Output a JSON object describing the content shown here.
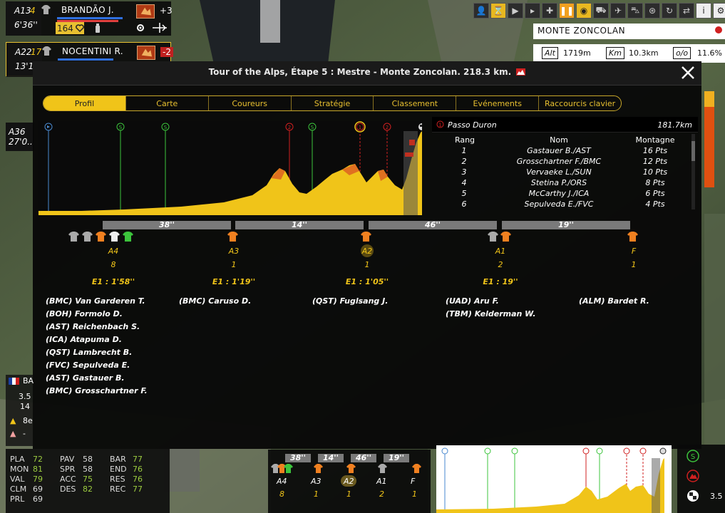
{
  "riders": [
    {
      "team_code": "A13",
      "num": "4",
      "time": "6'36''",
      "name": "BRANDÃO J.",
      "delta": "+3",
      "energy": "164"
    },
    {
      "team_code": "A22",
      "num": "17",
      "time": "13'1..",
      "name": "NOCENTINI R.",
      "delta": "-2"
    },
    {
      "team_code": "A36",
      "time": "27'0.."
    }
  ],
  "climb_panel": {
    "title": "MONTE ZONCOLAN",
    "alt_key": "Alt",
    "alt": "1719m",
    "km_key": "Km",
    "km": "10.3km",
    "grade_key": "o/o",
    "grade": "11.6%"
  },
  "modal": {
    "title": "Tour of the Alps, Étape 5 : Mestre - Monte Zoncolan. 218.3 km.",
    "tabs": [
      "Profil",
      "Carte",
      "Coureurs",
      "Stratégie",
      "Classement",
      "Evénements",
      "Raccourcis clavier"
    ],
    "active_tab": "Profil"
  },
  "climb_table": {
    "name": "Passo Duron",
    "km": "181.7km",
    "headers": [
      "Rang",
      "Nom",
      "Montagne"
    ],
    "rows": [
      {
        "rank": "1",
        "name": "Gastauer B./AST",
        "pts": "16 Pts"
      },
      {
        "rank": "2",
        "name": "Grosschartner F./BMC",
        "pts": "12 Pts"
      },
      {
        "rank": "3",
        "name": "Vervaeke L./SUN",
        "pts": "10 Pts"
      },
      {
        "rank": "4",
        "name": "Stetina P./ORS",
        "pts": "8 Pts"
      },
      {
        "rank": "5",
        "name": "McCarthy J./ICA",
        "pts": "6 Pts"
      },
      {
        "rank": "6",
        "name": "Sepulveda E./FVC",
        "pts": "4 Pts"
      }
    ]
  },
  "gaps": [
    "38''",
    "14''",
    "46''",
    "19''"
  ],
  "groups": [
    {
      "label": "A4",
      "count": "8",
      "gap": "E1 : 1'58''",
      "riders": [
        "(BMC) Van Garderen T.",
        "(BOH) Formolo D.",
        "(AST) Reichenbach S.",
        "(ICA) Atapuma D.",
        "(QST) Lambrecht B.",
        "(FVC) Sepulveda E.",
        "(AST) Gastauer B.",
        "(BMC) Grosschartner F."
      ]
    },
    {
      "label": "A3",
      "count": "1",
      "gap": "E1 : 1'19''",
      "riders": [
        "(BMC) Caruso D."
      ]
    },
    {
      "label": "A2",
      "count": "1",
      "gap": "E1 : 1'05''",
      "riders": [
        "(QST) Fuglsang J."
      ]
    },
    {
      "label": "A1",
      "count": "2",
      "gap": "E1 : 19''",
      "riders": [
        "(UAD) Aru F.",
        "(TBM) Kelderman W."
      ]
    },
    {
      "label": "F",
      "count": "1",
      "gap": "",
      "riders": [
        "(ALM) Bardet R."
      ]
    }
  ],
  "stats": [
    {
      "k": "PLA",
      "v": "72"
    },
    {
      "k": "PAV",
      "v": "58"
    },
    {
      "k": "BAR",
      "v": "77"
    },
    {
      "k": "MON",
      "v": "81"
    },
    {
      "k": "SPR",
      "v": "58"
    },
    {
      "k": "END",
      "v": "76"
    },
    {
      "k": "VAL",
      "v": "79"
    },
    {
      "k": "ACC",
      "v": "75"
    },
    {
      "k": "RES",
      "v": "76"
    },
    {
      "k": "CLM",
      "v": "69"
    },
    {
      "k": "DES",
      "v": "82"
    },
    {
      "k": "REC",
      "v": "77"
    },
    {
      "k": "PRL",
      "v": "69"
    }
  ],
  "mini_groups": {
    "gaps": [
      "38''",
      "14''",
      "46''",
      "19''"
    ],
    "labels": [
      "A4",
      "A3",
      "A2",
      "A1",
      "F"
    ],
    "counts": [
      "8",
      "1",
      "1",
      "2",
      "1"
    ]
  },
  "bottom_left": {
    "v1": "3.5",
    "v2": "14",
    "v3": "8e",
    "v4": "-",
    "team_abbr": "BA"
  },
  "bottom_right": {
    "value": "3.5"
  },
  "colors": {
    "accent": "#f0c419",
    "sprint": "#3cc43c",
    "climb": "#d02020"
  }
}
